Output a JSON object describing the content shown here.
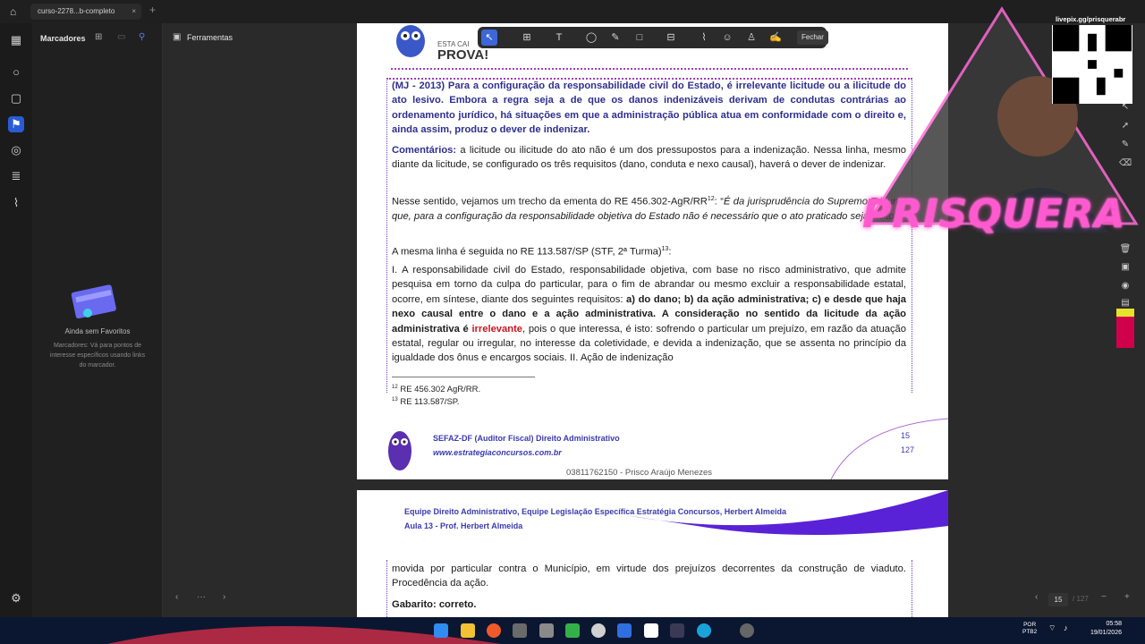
{
  "window": {
    "tab_title": "curso-2278...b-completo"
  },
  "sidebar": {
    "title": "Marcadores",
    "empty_title": "Ainda sem Favoritos",
    "empty_desc": "Marcadores: Vá para pontos de interesse específicos usando links do marcador."
  },
  "tools": {
    "title": "Ferramentas"
  },
  "annotation_toolbar": {
    "close_label": "Fechar"
  },
  "logo": {
    "line1": "ESTA CAI",
    "line2": "PROVA!"
  },
  "question": {
    "text": "(MJ - 2013) Para a configuração da responsabilidade civil do Estado, é irrelevante licitude ou a ilicitude do ato lesivo. Embora a regra seja a de que os danos indenizáveis derivam de condutas contrárias ao ordenamento jurídico, há situações em que a administração pública atua em conformidade com o direito e, ainda assim, produz o dever de indenizar."
  },
  "comments": {
    "label": "Comentários:",
    "text": " a licitude ou ilicitude do ato não é um dos pressupostos para a indenização. Nessa linha, mesmo diante da licitude, se configurado os três requisitos (dano, conduta e nexo causal), haverá o dever de indenizar."
  },
  "para1": {
    "pre": "Nesse sentido, vejamos um trecho da ementa do RE 456.302-AgR/RR",
    "sup": "12",
    "mid": ": “",
    "italic": "É da jurisprudência do Supremo Tribunal que, para a configuração da responsabilidade objetiva do Estado não é necessário que o ato praticado seja ilícito",
    "post": "”."
  },
  "para2": {
    "pre": "A mesma linha é seguida no RE 113.587/SP (STF, 2ª Turma)",
    "sup": "13",
    "post": ":"
  },
  "para3": {
    "a": "I. A responsabilidade civil do Estado, responsabilidade objetiva, com base no risco administrativo, que admite pesquisa em torno da culpa do particular, para o fim de abrandar ou mesmo excluir a responsabilidade estatal, ocorre, em síntese, diante dos seguintes requisitos: ",
    "b": "a) do dano; b) da ação administrativa; c) e desde que haja nexo causal entre o dano e a ação administrativa. A consideração no sentido da licitude da ação administrativa é ",
    "c": "irrelevante",
    "d": ", pois o que interessa, é isto: sofrendo o particular um prejuízo, em razão da atuação estatal, regular ou irregular, no interesse da coletividade, e devida a indenização, que se assenta no princípio da igualdade dos ônus e encargos sociais. II. Ação de indenização"
  },
  "footnotes": [
    {
      "num": "12",
      "text": " RE 456.302 AgR/RR."
    },
    {
      "num": "13",
      "text": " RE 113.587/SP."
    }
  ],
  "footer": {
    "course": "SEFAZ-DF (Auditor Fiscal) Direito Administrativo",
    "url": "www.estrategiaconcursos.com.br",
    "page": "15",
    "total": "127",
    "watermark": "03811762150 - Prisco Araújo Menezes"
  },
  "page2": {
    "header_line1": "Equipe Direito Administrativo, Equipe Legislação Específica Estratégia Concursos, Herbert Almeida",
    "header_line2": "Aula 13 - Prof. Herbert Almeida",
    "text": "movida por particular contra o Município, em virtude dos prejuízos decorrentes da construção de viaduto. Procedência da ação.",
    "gabarito": "Gabarito: correto."
  },
  "navigation": {
    "page_input": "15",
    "total": "/ 127"
  },
  "stream": {
    "livepix": "livepix.gg/prisquerabr",
    "name": "PRISQUERA"
  },
  "taskbar": {
    "lang1": "POR",
    "lang2": "PTB2",
    "time": "05:58",
    "date": "19/01/2026"
  }
}
